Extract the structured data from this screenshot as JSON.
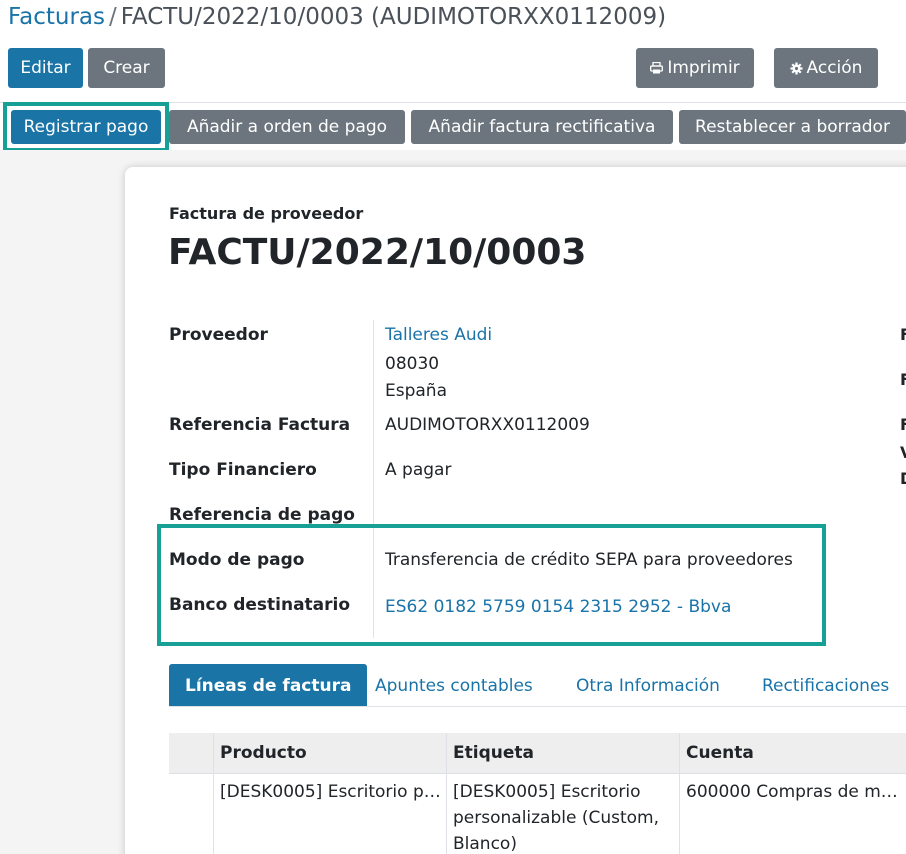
{
  "breadcrumb": {
    "parent": "Facturas",
    "separator": "/",
    "current": "FACTU/2022/10/0003 (AUDIMOTORXX0112009)"
  },
  "control_panel": {
    "edit_label": "Editar",
    "create_label": "Crear",
    "print_label": "Imprimir",
    "print_icon": "print-icon",
    "action_label": "Acción",
    "action_icon": "gear-icon"
  },
  "statusbar": {
    "register_payment": "Registrar pago",
    "add_payment_order": "Añadir a orden de pago",
    "add_credit_note": "Añadir factura rectificativa",
    "reset_draft": "Restablecer a borrador"
  },
  "document": {
    "type": "Factura de proveedor",
    "name": "FACTU/2022/10/0003"
  },
  "fields": {
    "vendor_label": "Proveedor",
    "vendor_name": "Talleres Audi",
    "vendor_zip": "08030",
    "vendor_country": "España",
    "ref_label": "Referencia Factura",
    "ref_value": "AUDIMOTORXX0112009",
    "fin_type_label": "Tipo Financiero",
    "fin_type_value": "A pagar",
    "pay_ref_label": "Referencia de pago",
    "pay_ref_value": "",
    "pay_mode_label": "Modo de pago",
    "pay_mode_value": "Transferencia de crédito SEPA para proveedores",
    "bank_label": "Banco destinatario",
    "bank_value": "ES62 0182 5759 0154 2315 2952 - Bbva"
  },
  "right_column_edge": [
    "F",
    "F",
    "F",
    "V",
    "D"
  ],
  "tabs": [
    {
      "label": "Líneas de factura",
      "active": true
    },
    {
      "label": "Apuntes contables",
      "active": false
    },
    {
      "label": "Otra Información",
      "active": false
    },
    {
      "label": "Rectificaciones",
      "active": false
    }
  ],
  "table": {
    "columns": [
      "Producto",
      "Etiqueta",
      "Cuenta"
    ],
    "rows": [
      {
        "product": "[DESK0005] Escritorio p…",
        "label": "[DESK0005] Escritorio personalizable (Custom, Blanco)",
        "account": "600000 Compras de m…"
      }
    ]
  },
  "colors": {
    "primary": "#1b74a6",
    "secondary": "#6c757d",
    "highlight": "#17a096",
    "link": "#1a73a8"
  }
}
